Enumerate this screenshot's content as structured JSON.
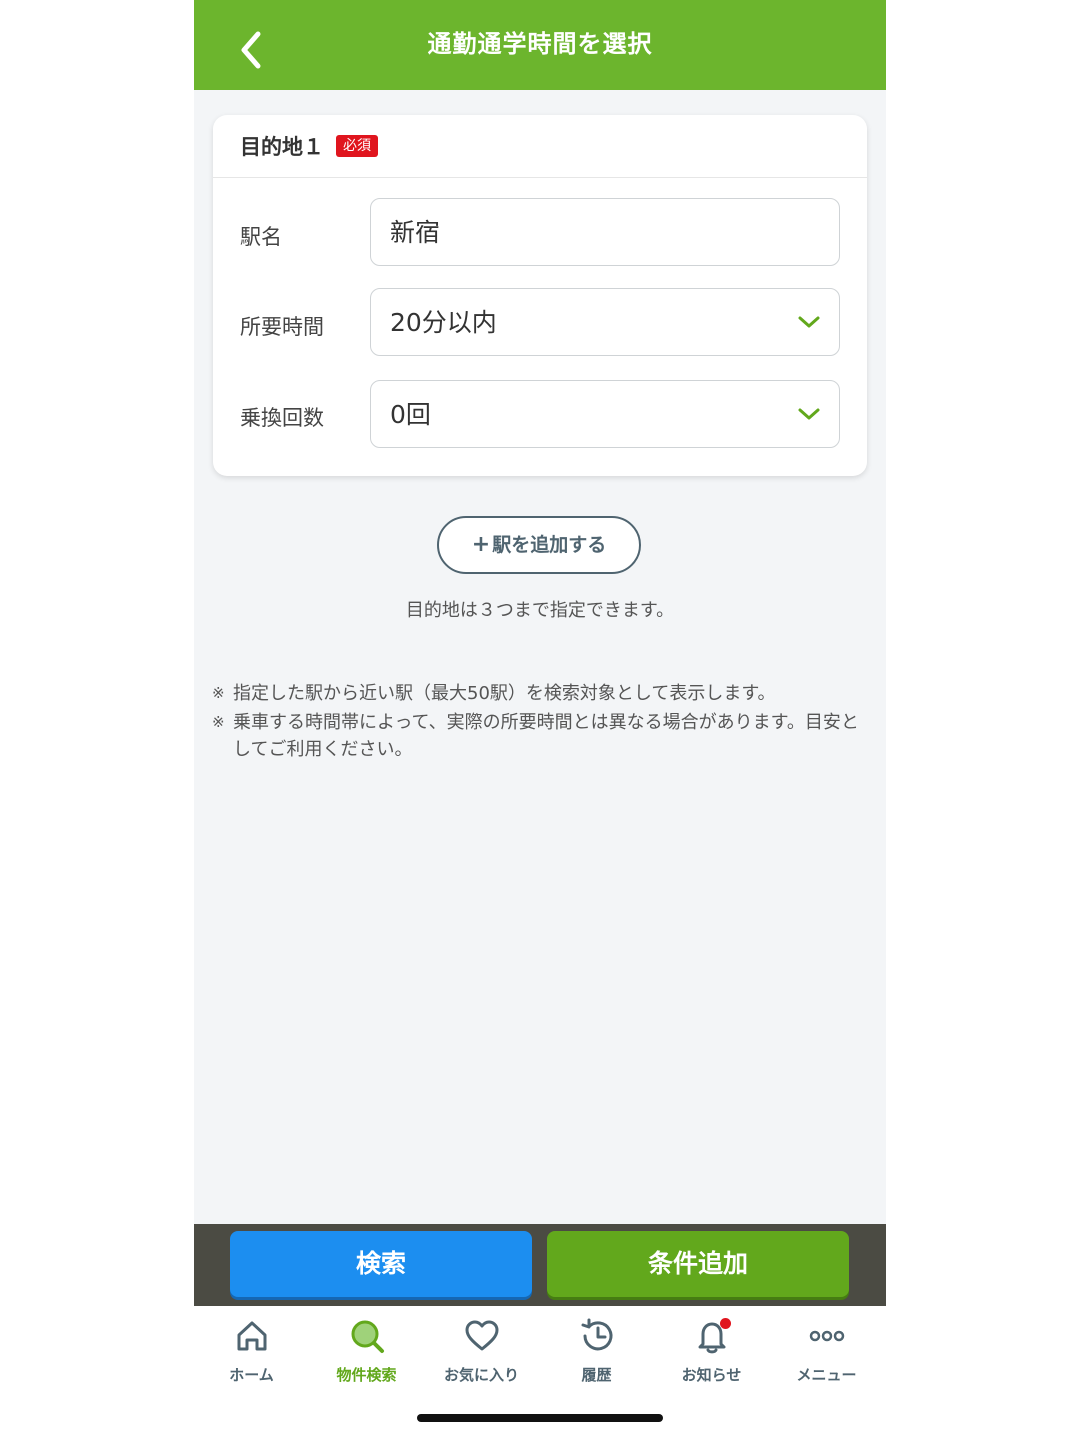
{
  "header": {
    "title": "通勤通学時間を選択"
  },
  "destination": {
    "title": "目的地１",
    "required_label": "必須",
    "station": {
      "label": "駅名",
      "value": "新宿"
    },
    "time": {
      "label": "所要時間",
      "value": "20分以内"
    },
    "transfers": {
      "label": "乗換回数",
      "value": "0回"
    }
  },
  "add_station": {
    "icon": "+",
    "label": "駅を追加する"
  },
  "hint": "目的地は３つまで指定できます。",
  "notes": [
    "指定した駅から近い駅（最大50駅）を検索対象として表示します。",
    "乗車する時間帯によって、実際の所要時間とは異なる場合があります。目安としてご利用ください。"
  ],
  "note_mark": "※",
  "actions": {
    "search": "検索",
    "add_condition": "条件追加"
  },
  "tabs": [
    {
      "label": "ホーム",
      "icon": "home-icon"
    },
    {
      "label": "物件検索",
      "icon": "search-icon"
    },
    {
      "label": "お気に入り",
      "icon": "heart-icon"
    },
    {
      "label": "履歴",
      "icon": "history-icon"
    },
    {
      "label": "お知らせ",
      "icon": "bell-icon"
    },
    {
      "label": "メニュー",
      "icon": "more-icon"
    }
  ],
  "colors": {
    "brand_green": "#6cb52d",
    "search_blue": "#1c8ef0",
    "required_red": "#e0151e"
  }
}
